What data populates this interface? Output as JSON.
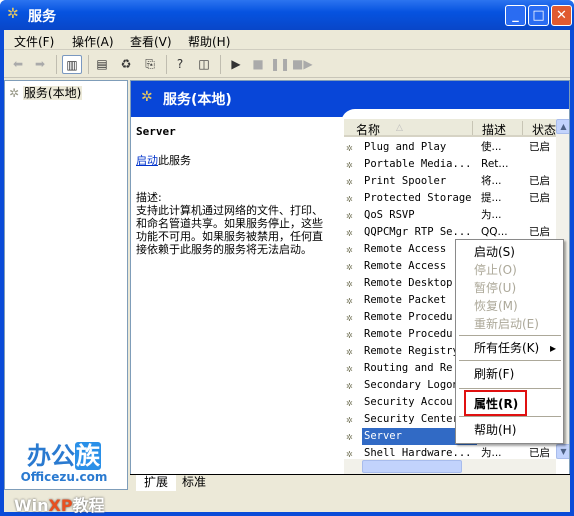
{
  "window": {
    "title": "服务",
    "icon": "services-gear-icon"
  },
  "menu": [
    "文件(F)",
    "操作(A)",
    "查看(V)",
    "帮助(H)"
  ],
  "toolbar": [
    "back",
    "forward",
    "show-hide-tree",
    "properties",
    "refresh",
    "export",
    "help",
    "show-hide-action",
    "start",
    "stop",
    "pause",
    "restart"
  ],
  "tree": {
    "root": "服务(本地)"
  },
  "pane": {
    "title": "服务(本地)",
    "service_name": "Server",
    "start_link": "启动",
    "start_suffix": "此服务",
    "desc_label": "描述:",
    "desc_text": "支持此计算机通过网络的文件、打印、和命名管道共享。如果服务停止，这些功能不可用。如果服务被禁用，任何直接依赖于此服务的服务将无法启动。"
  },
  "list": {
    "columns": [
      "名称",
      "描述",
      "状态"
    ],
    "rows": [
      {
        "name": "Plug and Play",
        "desc": "使...",
        "status": "已启"
      },
      {
        "name": "Portable Media...",
        "desc": "Ret...",
        "status": ""
      },
      {
        "name": "Print Spooler",
        "desc": "将...",
        "status": "已启"
      },
      {
        "name": "Protected Storage",
        "desc": "提...",
        "status": "已启"
      },
      {
        "name": "QoS RSVP",
        "desc": "为...",
        "status": ""
      },
      {
        "name": "QQPCMgr RTP Se...",
        "desc": "QQ...",
        "status": "已启"
      },
      {
        "name": "Remote Access ...",
        "desc": "",
        "status": ""
      },
      {
        "name": "Remote Access ...",
        "desc": "",
        "status": ""
      },
      {
        "name": "Remote Desktop...",
        "desc": "",
        "status": ""
      },
      {
        "name": "Remote Packet ...",
        "desc": "",
        "status": ""
      },
      {
        "name": "Remote Procedu...",
        "desc": "",
        "status": ""
      },
      {
        "name": "Remote Procedu...",
        "desc": "",
        "status": ""
      },
      {
        "name": "Remote Registry",
        "desc": "",
        "status": ""
      },
      {
        "name": "Routing and Re...",
        "desc": "",
        "status": ""
      },
      {
        "name": "Secondary Logon",
        "desc": "",
        "status": ""
      },
      {
        "name": "Security Accou...",
        "desc": "",
        "status": ""
      },
      {
        "name": "Security Center",
        "desc": "",
        "status": ""
      },
      {
        "name": "Server",
        "desc": "",
        "status": "",
        "selected": true
      },
      {
        "name": "Shell Hardware...",
        "desc": "为...",
        "status": "已启"
      }
    ]
  },
  "context_menu": {
    "items": [
      {
        "label": "启动(S)",
        "enabled": true
      },
      {
        "label": "停止(O)",
        "enabled": false
      },
      {
        "label": "暂停(U)",
        "enabled": false
      },
      {
        "label": "恢复(M)",
        "enabled": false
      },
      {
        "label": "重新启动(E)",
        "enabled": false
      },
      {
        "label": "所有任务(K)",
        "enabled": true,
        "submenu": true
      },
      {
        "label": "刷新(F)",
        "enabled": true
      },
      {
        "label": "属性(R)",
        "enabled": true,
        "bold": true,
        "highlighted_box": true
      },
      {
        "label": "帮助(H)",
        "enabled": true
      }
    ]
  },
  "tabs": [
    "扩展",
    "标准"
  ],
  "watermark": {
    "logo_cn": "办公族",
    "logo_en": "Officezu.com",
    "site": "WinXP教程"
  },
  "colors": {
    "title_blue": "#0653e0",
    "selection": "#316ac5",
    "highlight_box": "#e01010"
  }
}
